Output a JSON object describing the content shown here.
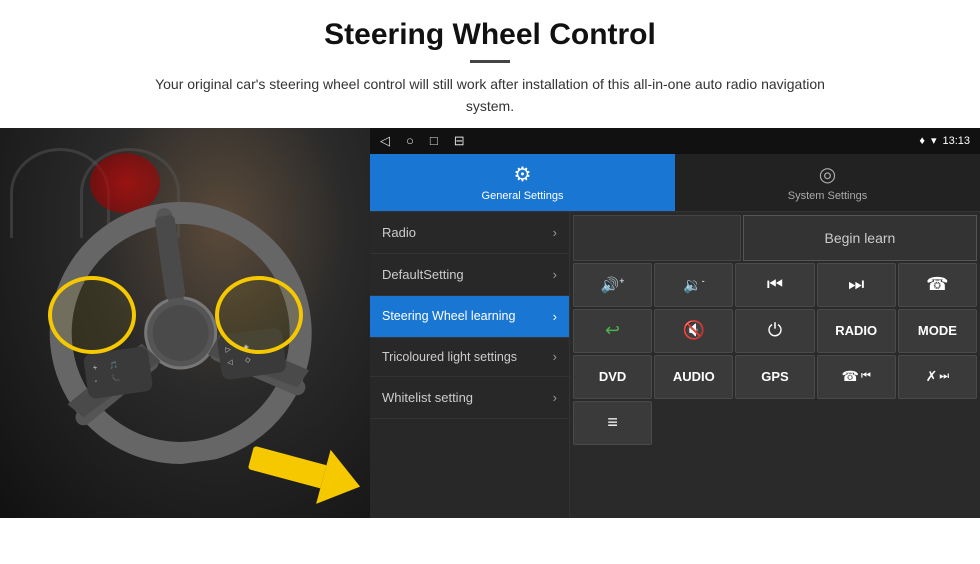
{
  "header": {
    "title": "Steering Wheel Control",
    "subtitle": "Your original car's steering wheel control will still work after installation of this all-in-one auto radio navigation system."
  },
  "status_bar": {
    "icons": [
      "◁",
      "○",
      "□",
      "⊟"
    ],
    "right_text": "13:13",
    "signal_icon": "♦",
    "wifi_icon": "▾"
  },
  "tabs": [
    {
      "id": "general",
      "label": "General Settings",
      "icon": "⚙",
      "active": true
    },
    {
      "id": "system",
      "label": "System Settings",
      "icon": "◎",
      "active": false
    }
  ],
  "menu": {
    "items": [
      {
        "id": "radio",
        "label": "Radio",
        "active": false
      },
      {
        "id": "default-setting",
        "label": "DefaultSetting",
        "active": false
      },
      {
        "id": "steering-wheel",
        "label": "Steering Wheel learning",
        "active": true
      },
      {
        "id": "tricoloured",
        "label": "Tricoloured light settings",
        "active": false
      },
      {
        "id": "whitelist",
        "label": "Whitelist setting",
        "active": false
      }
    ]
  },
  "control_panel": {
    "begin_learn_label": "Begin learn",
    "buttons_row1": [
      {
        "id": "vol-up",
        "symbol": "🔊+",
        "label": "vol-up"
      },
      {
        "id": "vol-down",
        "symbol": "🔉-",
        "label": "vol-down"
      },
      {
        "id": "prev-track",
        "symbol": "⏮",
        "label": "prev-track"
      },
      {
        "id": "next-track",
        "symbol": "⏭",
        "label": "next-track"
      },
      {
        "id": "phone",
        "symbol": "☎",
        "label": "phone"
      }
    ],
    "buttons_row2": [
      {
        "id": "answer",
        "symbol": "↩",
        "label": "answer-call"
      },
      {
        "id": "mute",
        "symbol": "🔇",
        "label": "mute"
      },
      {
        "id": "power",
        "symbol": "⏻",
        "label": "power"
      },
      {
        "id": "radio-btn",
        "label": "RADIO",
        "text": true
      },
      {
        "id": "mode-btn",
        "label": "MODE",
        "text": true
      }
    ],
    "buttons_row3": [
      {
        "id": "dvd",
        "label": "DVD",
        "text": true
      },
      {
        "id": "audio",
        "label": "AUDIO",
        "text": true
      },
      {
        "id": "gps",
        "label": "GPS",
        "text": true
      },
      {
        "id": "phone2",
        "symbol": "☎⏮",
        "label": "phone-prev"
      },
      {
        "id": "skip",
        "symbol": "⏭✗",
        "label": "skip"
      }
    ],
    "buttons_row4": [
      {
        "id": "menu-icon",
        "symbol": "≡",
        "label": "menu-icon"
      }
    ]
  }
}
